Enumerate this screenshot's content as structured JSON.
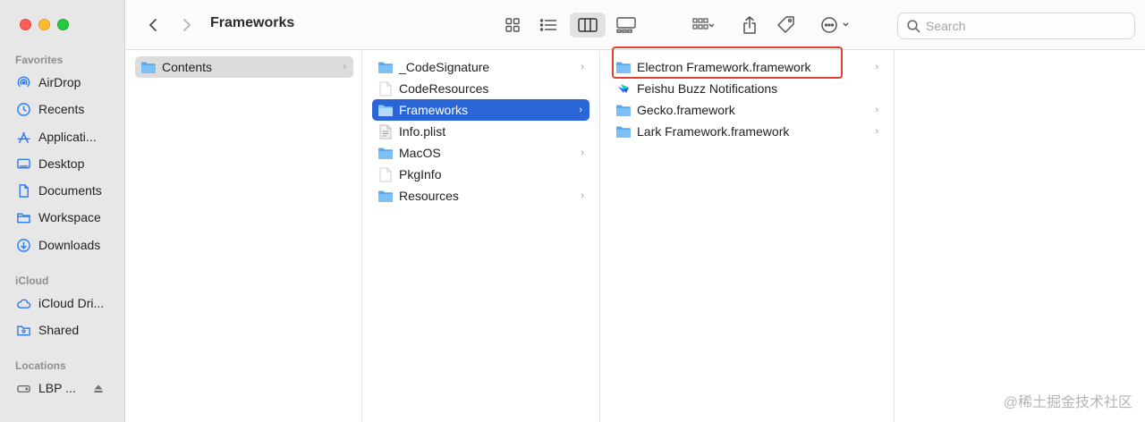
{
  "toolbar": {
    "title": "Frameworks",
    "search_placeholder": "Search",
    "back_icon": "chevron-left-icon",
    "forward_icon": "chevron-right-icon"
  },
  "sidebar": {
    "favorites_heading": "Favorites",
    "favorites": [
      {
        "label": "AirDrop",
        "icon": "airdrop-icon"
      },
      {
        "label": "Recents",
        "icon": "clock-icon"
      },
      {
        "label": "Applicati...",
        "icon": "applications-icon"
      },
      {
        "label": "Desktop",
        "icon": "desktop-icon"
      },
      {
        "label": "Documents",
        "icon": "document-icon"
      },
      {
        "label": "Workspace",
        "icon": "folder-icon"
      },
      {
        "label": "Downloads",
        "icon": "download-icon"
      }
    ],
    "icloud_heading": "iCloud",
    "icloud": [
      {
        "label": "iCloud Dri...",
        "icon": "cloud-icon"
      },
      {
        "label": "Shared",
        "icon": "shared-folder-icon"
      }
    ],
    "locations_heading": "Locations",
    "locations": [
      {
        "label": "LBP ...",
        "icon": "disk-icon"
      }
    ]
  },
  "columns": {
    "col1": [
      {
        "label": "Contents",
        "type": "folder",
        "has_children": true,
        "selected": "inactive"
      }
    ],
    "col2": [
      {
        "label": "_CodeSignature",
        "type": "folder",
        "has_children": true
      },
      {
        "label": "CodeResources",
        "type": "file",
        "has_children": false
      },
      {
        "label": "Frameworks",
        "type": "folder",
        "has_children": true,
        "selected": "active"
      },
      {
        "label": "Info.plist",
        "type": "plist",
        "has_children": false
      },
      {
        "label": "MacOS",
        "type": "folder",
        "has_children": true
      },
      {
        "label": "PkgInfo",
        "type": "file",
        "has_children": false
      },
      {
        "label": "Resources",
        "type": "folder",
        "has_children": true
      }
    ],
    "col3": [
      {
        "label": "Electron Framework.framework",
        "type": "folder",
        "has_children": true
      },
      {
        "label": "Feishu Buzz Notifications",
        "type": "app",
        "has_children": false
      },
      {
        "label": "Gecko.framework",
        "type": "folder",
        "has_children": true
      },
      {
        "label": "Lark Framework.framework",
        "type": "folder",
        "has_children": true
      }
    ]
  },
  "watermark": "@稀土掘金技术社区",
  "colors": {
    "accent": "#2b66d9",
    "highlight_box": "#e0402f",
    "folder": "#5aa9ea"
  }
}
